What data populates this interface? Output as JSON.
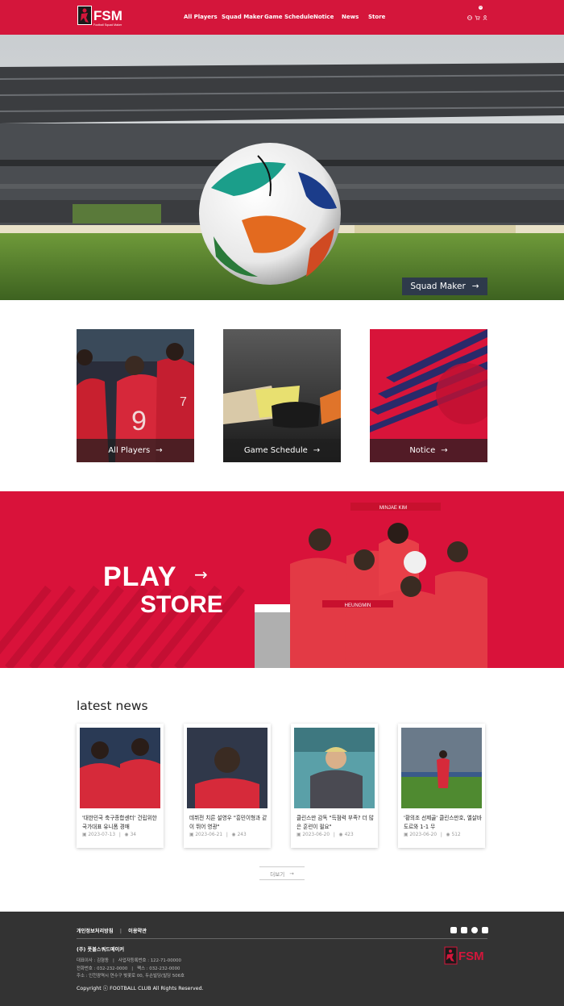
{
  "header": {
    "logo_text": "FSM",
    "logo_sub": "Football Squad Maker",
    "nav": [
      "All Players",
      "Squad Maker",
      "Game Schedule",
      "Notice",
      "News",
      "Store"
    ],
    "cart_count": "0"
  },
  "hero": {
    "button_label": "Squad Maker",
    "arrow": "→"
  },
  "cards": [
    {
      "label": "All Players",
      "arrow": "→"
    },
    {
      "label": "Game Schedule",
      "arrow": "→"
    },
    {
      "label": "Notice",
      "arrow": "→"
    }
  ],
  "banner": {
    "play": "PLAY",
    "store": "STORE",
    "arrow": "→",
    "scarf_top": "MINJAE KIM",
    "scarf_bottom": "HEUNGMIN"
  },
  "news": {
    "title": "latest news",
    "items": [
      {
        "text": "'대한민국 축구종합센터' 건립위한 국가대표 유니폼 경매",
        "date": "2023-07-13",
        "views": "34"
      },
      {
        "text": "데뷔전 치른 설영우 \"흥민이형과 같이 뛰어 영광\"",
        "date": "2023-06-21",
        "views": "243"
      },
      {
        "text": "클린스만 감독 \"득점력 부족? 더 많은 훈련이 필요\"",
        "date": "2023-06-20",
        "views": "423"
      },
      {
        "text": "'황의조 선제골' 클린스만호, 엘살바도르와 1-1 무",
        "date": "2023-06-20",
        "views": "512"
      }
    ],
    "more_label": "더보기",
    "more_arrow": "→"
  },
  "footer": {
    "privacy": "개인정보처리방침",
    "divider": "|",
    "terms": "이용약관",
    "company": "(주) 풋볼스쿼드메이커",
    "line1a": "대표이사 : 김형동",
    "line1b": "사업자등록번호 : 122-71-00000",
    "line2a": "전화번호 : 032-232-0000",
    "line2b": "팩스 : 032-232-0000",
    "line3": "주소 : 인천광역시 연수구 벚꽃로 00, 두손빌딩(빌딩 506호",
    "copyright": "Copyright ⓒ FOOTBALL CLUB All Rights Reserved.",
    "social": [
      "facebook-icon",
      "instagram-icon",
      "talk-icon",
      "youtube-icon"
    ]
  },
  "colors": {
    "brand": "#d4163b",
    "footer": "#333333",
    "hero_button": "#2e3a4b"
  }
}
